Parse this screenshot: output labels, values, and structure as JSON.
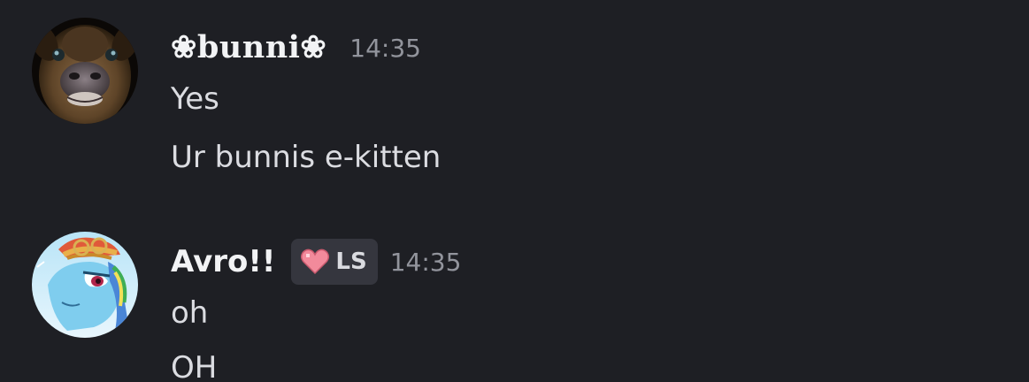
{
  "messages": [
    {
      "author": "❀bunni❀",
      "avatar": "deer-photo-avatar",
      "timestamp": "14:35",
      "lines": [
        "Yes",
        "Ur bunnis e-kitten"
      ]
    },
    {
      "author": "Avro!!",
      "avatar": "pony-avatar",
      "badge": {
        "icon": "heart-icon",
        "label": "LS"
      },
      "timestamp": "14:35",
      "lines": [
        "oh",
        "OH"
      ]
    }
  ],
  "colors": {
    "background": "#1e1f24",
    "username": "#f2f3f5",
    "message_text": "#dbdce1",
    "timestamp": "#92949c",
    "badge_background": "#35363e",
    "badge_heart": "#f28a9b"
  }
}
